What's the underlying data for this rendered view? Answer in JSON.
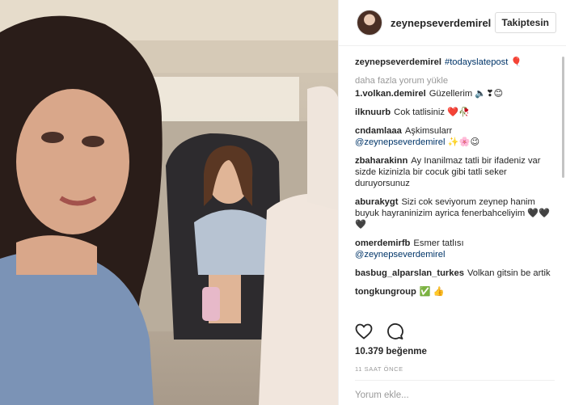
{
  "post": {
    "username": "zeynepseverdemirel",
    "follow_label": "Takiptesin",
    "caption": {
      "user": "zeynepseverdemirel",
      "text": "#todayslatepost 🎈"
    },
    "load_more_label": "daha fazla yorum yükle",
    "likes_label": "10.379 beğenme",
    "time_label": "11 SAAT ÖNCE",
    "comment_placeholder": "Yorum ekle..."
  },
  "comments": [
    {
      "user": "1.volkan.demirel",
      "text": "Güzellerim 🔈❣😊"
    },
    {
      "user": "ilknuurb",
      "text": "Cok tatlisiniz ❤️🥀"
    },
    {
      "user": "cndamlaaa",
      "text": "Aşkimsularr",
      "mention": "@zeynepseverdemirel",
      "after": " ✨🌸😉"
    },
    {
      "user": "zbaharakinn",
      "text": "Ay Inanilmaz tatli bir ifadeniz var sizde kizinizla bir cocuk gibi tatli seker duruyorsunuz"
    },
    {
      "user": "aburakygt",
      "text": "Sizi cok seviyorum zeynep hanim buyuk hayraninizim ayrica fenerbahceliyim 🖤🖤🖤"
    },
    {
      "user": "omerdemirfb",
      "text": "Esmer tatlısı",
      "mention": "@zeynepseverdemirel",
      "after": ""
    },
    {
      "user": "basbug_alparslan_turkes",
      "text": "Volkan gitsin be artik"
    },
    {
      "user": "tongkungroup",
      "text": "✅ 👍"
    }
  ],
  "icons": {
    "like": "heart-icon",
    "comment": "comment-bubble-icon"
  }
}
